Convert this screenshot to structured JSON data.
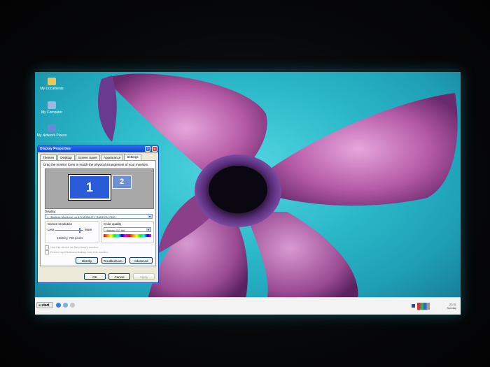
{
  "desktop": {
    "icons": [
      {
        "label": "My Documents",
        "icon": "folder-icon"
      },
      {
        "label": "My Computer",
        "icon": "computer-icon"
      },
      {
        "label": "My Network Places",
        "icon": "network-icon"
      }
    ]
  },
  "dialog": {
    "title": "Display Properties",
    "help_label": "?",
    "close_label": "×",
    "tabs": [
      "Themes",
      "Desktop",
      "Screen Saver",
      "Appearance",
      "Settings"
    ],
    "active_tab": "Settings",
    "instruction": "Drag the monitor icons to match the physical arrangement of your monitors.",
    "monitor1_label": "1",
    "monitor2_label": "2",
    "display_label": "Display:",
    "display_value": "1. (Multiple Monitors) on ATI MOBILITY RADEON 7500",
    "resolution_label": "Screen resolution",
    "resolution_less": "Less",
    "resolution_more": "More",
    "resolution_value": "1360 by 768 pixels",
    "color_label": "Color quality",
    "color_value": "Highest (32 bit)",
    "check_primary": "Use this device as the primary monitor.",
    "check_extend": "Extend my Windows desktop onto this monitor.",
    "identify_label": "Identify",
    "troubleshoot_label": "Troubleshoot...",
    "advanced_label": "Advanced",
    "ok_label": "OK",
    "cancel_label": "Cancel",
    "apply_label": "Apply"
  },
  "taskbar": {
    "start_label": "start",
    "clock_time": "22:31",
    "clock_day": "Sunday"
  },
  "colors": {
    "titlebar": "#0a43d6",
    "wallpaper": "#2ab8c8",
    "petal": "#b55aa6"
  }
}
